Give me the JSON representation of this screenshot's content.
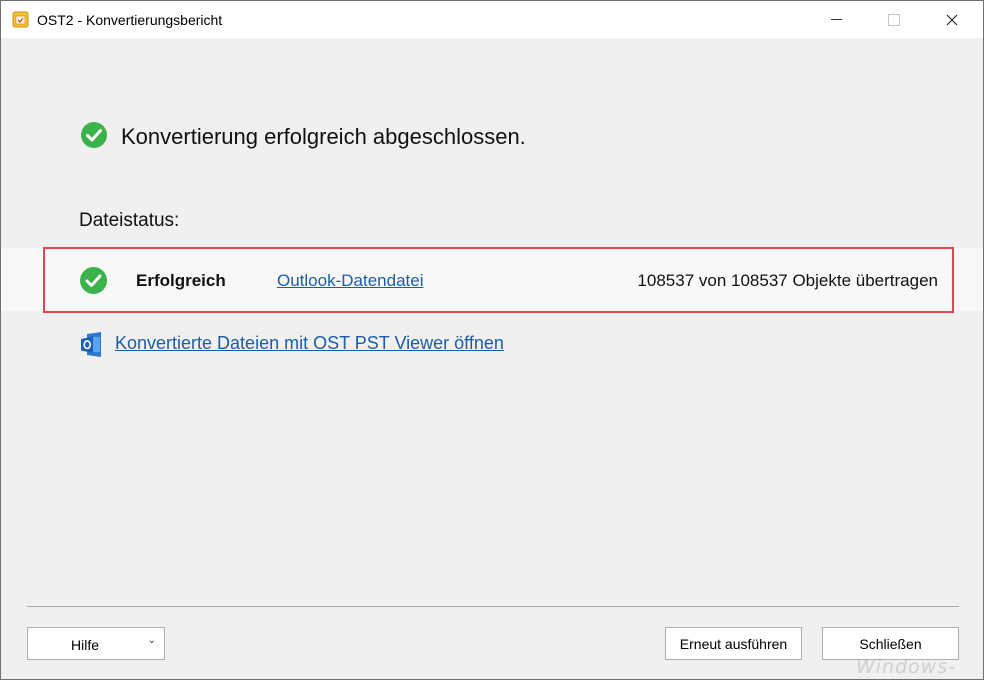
{
  "window": {
    "title": "OST2 - Konvertierungsbericht"
  },
  "main": {
    "headline": "Konvertierung erfolgreich abgeschlossen.",
    "section_label": "Dateistatus:",
    "file_row": {
      "status": "Erfolgreich",
      "link": "Outlook-Datendatei ",
      "count_text": "108537 von 108537 Objekte übertragen"
    },
    "viewer_link": "Konvertierte Dateien mit OST PST Viewer öffnen"
  },
  "footer": {
    "help_label": "Hilfe",
    "retry_label": "Erneut ausführen",
    "close_label": "Schließen"
  },
  "watermark": "Windows-FAQ",
  "icons": {
    "app": "ost2-app-icon",
    "success": "check-circle-icon",
    "viewer": "outlook-viewer-icon",
    "dropdown": "chevron-down-icon"
  },
  "colors": {
    "success_green": "#3cb24a",
    "link_blue": "#1a5ea6",
    "highlight_red": "#e0474c"
  }
}
